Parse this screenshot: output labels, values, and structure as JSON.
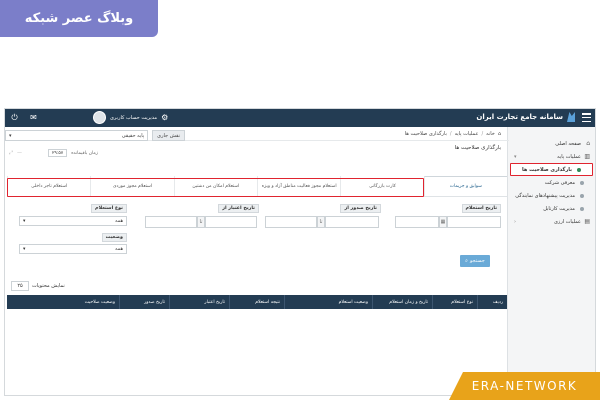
{
  "blog_banner": "وبلاگ عصر شبکه",
  "watermark": "ERA-NETWORK",
  "topbar": {
    "brand": "سامانه جامع تجارت ایران",
    "user_label": "مدیریت حساب کاربری"
  },
  "sidebar": {
    "items": [
      {
        "label": "صفحه اصلی"
      },
      {
        "label": "عملیات پایه"
      },
      {
        "label": "بارگذاری صلاحیت ها"
      },
      {
        "label": "معرفی شرکت"
      },
      {
        "label": "مدیریت پیشنهادهای نمایندگی"
      },
      {
        "label": "مدیریت کارتابل"
      },
      {
        "label": "عملیات ارزی"
      }
    ]
  },
  "main": {
    "breadcrumb": [
      "خانه",
      "عملیات پایه",
      "بارگذاری صلاحیت ها"
    ],
    "page_title": "بارگذاری صلاحیت ها",
    "role_button": "نقش جاری",
    "role_value": "پایه حقیقی",
    "time_label": "زمان باقیمانده",
    "time_value": "۲۹:۵۷",
    "tabs": [
      "سوابق و جریمات",
      "کارت بازرگانی",
      "استعلام مجوز فعالیت مناطق آزاد و ویژه",
      "استعلام امکان من دشتین",
      "استعلام مجوز موردی",
      "استعلام تاجر داخلی"
    ],
    "filters": {
      "inquiry_date": "تاریخ استعلام",
      "issue_date_from": "تاریخ صدور از",
      "validity_date_from": "تاریخ اعتبار از",
      "inquiry_type": "نوع استعلام",
      "inquiry_type_value": "همه",
      "status": "وضعیت",
      "status_value": "همه",
      "to_label": "تا"
    },
    "search_button": "جستجو",
    "page_size_label": "نمایش محتویات",
    "page_size_value": "۲۵",
    "table_headers": [
      "ردیف",
      "نوع استعلام",
      "تاریخ و زمان استعلام",
      "وضعیت استعلام",
      "نتیجه استعلام",
      "تاریخ اعتبار",
      "تاریخ صدور",
      "وضعیت صلاحیت"
    ]
  },
  "colors": {
    "topbar": "#233c53",
    "highlight": "#e0242f",
    "banner": "#7b7ec9",
    "watermark": "#e8a31a",
    "search_button": "#6aaad7"
  }
}
